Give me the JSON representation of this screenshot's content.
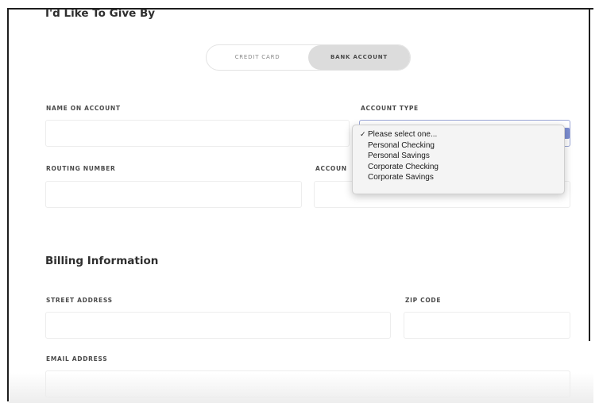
{
  "payment": {
    "heading": "I'd Like To Give By",
    "toggle": {
      "credit_card": "CREDIT CARD",
      "bank_account": "BANK ACCOUNT"
    }
  },
  "bank_form": {
    "name_on_account_label": "NAME ON ACCOUNT",
    "account_type_label": "ACCOUNT TYPE",
    "routing_number_label": "ROUTING NUMBER",
    "account_number_label": "ACCOUN"
  },
  "account_type_dropdown": {
    "options": [
      {
        "label": "Please select one...",
        "selected": true
      },
      {
        "label": "Personal Checking",
        "selected": false
      },
      {
        "label": "Personal Savings",
        "selected": false
      },
      {
        "label": "Corporate Checking",
        "selected": false
      },
      {
        "label": "Corporate Savings",
        "selected": false
      }
    ],
    "check_glyph": "✓"
  },
  "billing": {
    "heading": "Billing Information",
    "street_address_label": "STREET ADDRESS",
    "zip_code_label": "ZIP CODE",
    "email_address_label": "EMAIL ADDRESS"
  },
  "colors": {
    "toggle_active_bg": "#dcdcdc",
    "select_focus_border": "#9aa6d6",
    "field_border": "#ededed"
  }
}
